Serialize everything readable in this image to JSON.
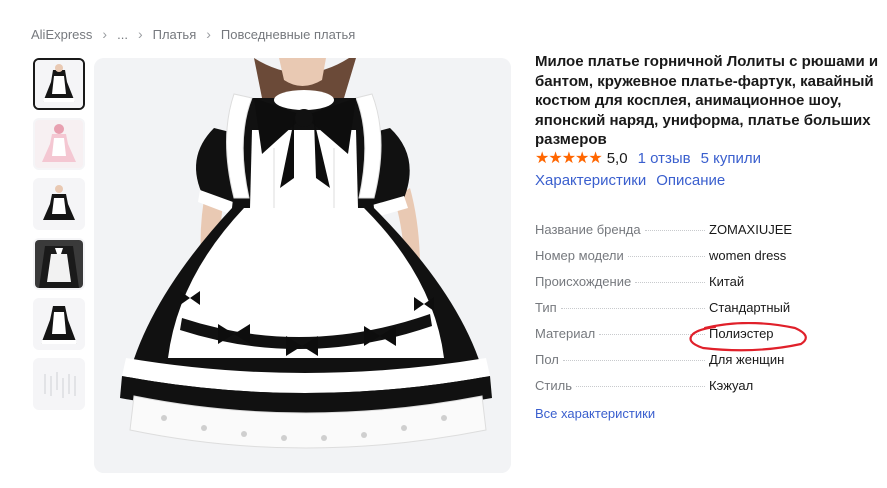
{
  "breadcrumb": {
    "items": [
      "AliExpress",
      "...",
      "Платья",
      "Повседневные платья"
    ],
    "separator": "›"
  },
  "product": {
    "title": "Милое платье горничной Лолиты с рюшами и бантом, кружевное платье-фартук, кавайный костюм для косплея, анимационное шоу, японский наряд, униформа, платье больших размеров",
    "rating": {
      "stars": "★★★★★",
      "score": "5,0",
      "reviews": "1 отзыв",
      "sold": "5 купили"
    },
    "tabs": [
      "Характеристики",
      "Описание"
    ]
  },
  "gallery": {
    "thumbnails": [
      "dress-thumb-1",
      "dress-thumb-2",
      "dress-thumb-3",
      "dress-thumb-4",
      "dress-thumb-5",
      "size-chart-thumb"
    ],
    "active_index": 0
  },
  "specs": [
    {
      "key": "Название бренда",
      "value": "ZOMAXIUJEE"
    },
    {
      "key": "Номер модели",
      "value": "women dress"
    },
    {
      "key": "Происхождение",
      "value": "Китай"
    },
    {
      "key": "Тип",
      "value": "Стандартный"
    },
    {
      "key": "Материал",
      "value": "Полиэстер"
    },
    {
      "key": "Пол",
      "value": "Для женщин"
    },
    {
      "key": "Стиль",
      "value": "Кэжуал"
    }
  ],
  "all_specs_link": "Все характеристики",
  "colors": {
    "accent_link": "#3a5fce",
    "star": "#ff6600",
    "highlight_circle": "#e0202a"
  }
}
